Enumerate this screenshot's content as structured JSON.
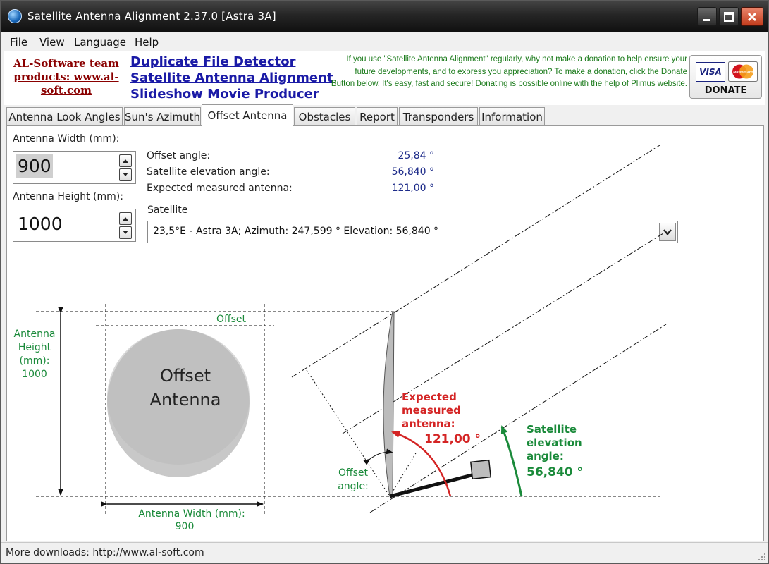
{
  "window": {
    "title": "Satellite Antenna Alignment 2.37.0 [Astra 3A]",
    "icon": "globe-icon"
  },
  "menu": {
    "items": [
      "File",
      "View",
      "Language",
      "Help"
    ]
  },
  "banner": {
    "team_link": "AL-Software team products: www.al-soft.com",
    "products": [
      "Duplicate File Detector",
      "Satellite Antenna Alignment",
      "Slideshow Movie Producer"
    ],
    "donate_text": "If you use \"Satellite Antenna Alignment\" regularly, why not make a donation to help ensure your future developments, and to express you appreciation? To make a donation, click the Donate Button below. It's easy, fast and secure! Donating is possible online with the help of Plimus website.",
    "donate_label": "DONATE",
    "visa": "VISA",
    "mastercard": "MasterCard"
  },
  "tabs": {
    "items": [
      "Antenna Look Angles",
      "Sun's Azimuth",
      "Offset Antenna",
      "Obstacles",
      "Report",
      "Transponders",
      "Information"
    ],
    "active": "Offset Antenna"
  },
  "form": {
    "width_label": "Antenna Width (mm):",
    "width_value": "900",
    "height_label": "Antenna Height (mm):",
    "height_value": "1000"
  },
  "results": {
    "offset_angle_label": "Offset angle:",
    "offset_angle_value": "25,84 °",
    "elevation_label": "Satellite elevation angle:",
    "elevation_value": "56,840 °",
    "expected_label": "Expected measured antenna:",
    "expected_value": "121,00 °"
  },
  "satellite": {
    "label": "Satellite",
    "selected": "23,5°E - Astra 3A;  Azimuth: 247,599 °  Elevation: 56,840 °"
  },
  "diagram": {
    "antenna_title_line1": "Offset",
    "antenna_title_line2": "Antenna",
    "offset_label": "Offset",
    "height_label_1": "Antenna",
    "height_label_2": "Height",
    "height_label_3": "(mm):",
    "height_label_4": "1000",
    "width_label": "Antenna Width (mm):",
    "width_value": "900",
    "expected_1": "Expected",
    "expected_2": "measured",
    "expected_3": "antenna:",
    "expected_value": "121,00 °",
    "offset_angle_1": "Offset",
    "offset_angle_2": "angle:",
    "elevation_1": "Satellite",
    "elevation_2": "elevation",
    "elevation_3": "angle:",
    "elevation_value": "56,840 °",
    "colors": {
      "green": "#1a8a3a",
      "red": "#d42424",
      "grey": "#c8c8c8"
    }
  },
  "status": {
    "text": "More downloads: http://www.al-soft.com"
  }
}
